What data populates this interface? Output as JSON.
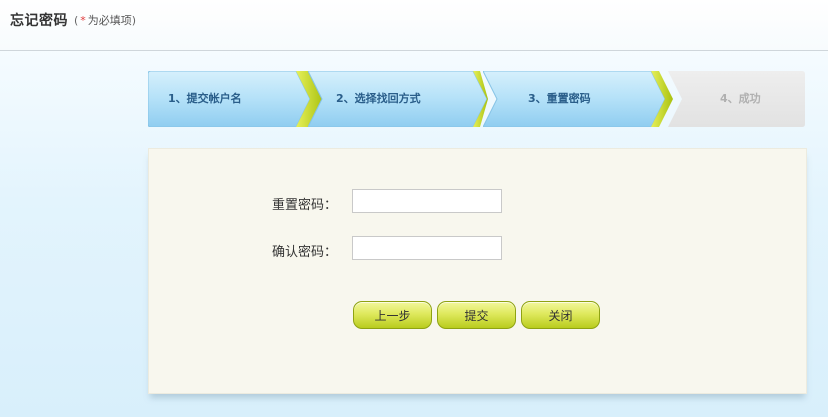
{
  "header": {
    "title": "忘记密码",
    "note_open": "(",
    "note_star": "*",
    "note_text": "为必填项",
    "note_close": ")"
  },
  "steps": [
    {
      "label": "1、提交帐户名",
      "state": "done"
    },
    {
      "label": "2、选择找回方式",
      "state": "done"
    },
    {
      "label": "3、重置密码",
      "state": "current"
    },
    {
      "label": "4、成功",
      "state": "pending"
    }
  ],
  "form": {
    "reset_password_label": "重置密码：",
    "reset_password_value": "",
    "confirm_password_label": "确认密码：",
    "confirm_password_value": ""
  },
  "buttons": {
    "prev": "上一步",
    "submit": "提交",
    "close": "关闭"
  },
  "colors": {
    "step_active_blue": "#a9dbf6",
    "step_arrow_green": "#c4d81c",
    "step_inactive_gray": "#e6e6e6",
    "panel_bg": "#f8f7ee",
    "button_green": "#dfe95e",
    "required_star": "#e03a3a"
  }
}
